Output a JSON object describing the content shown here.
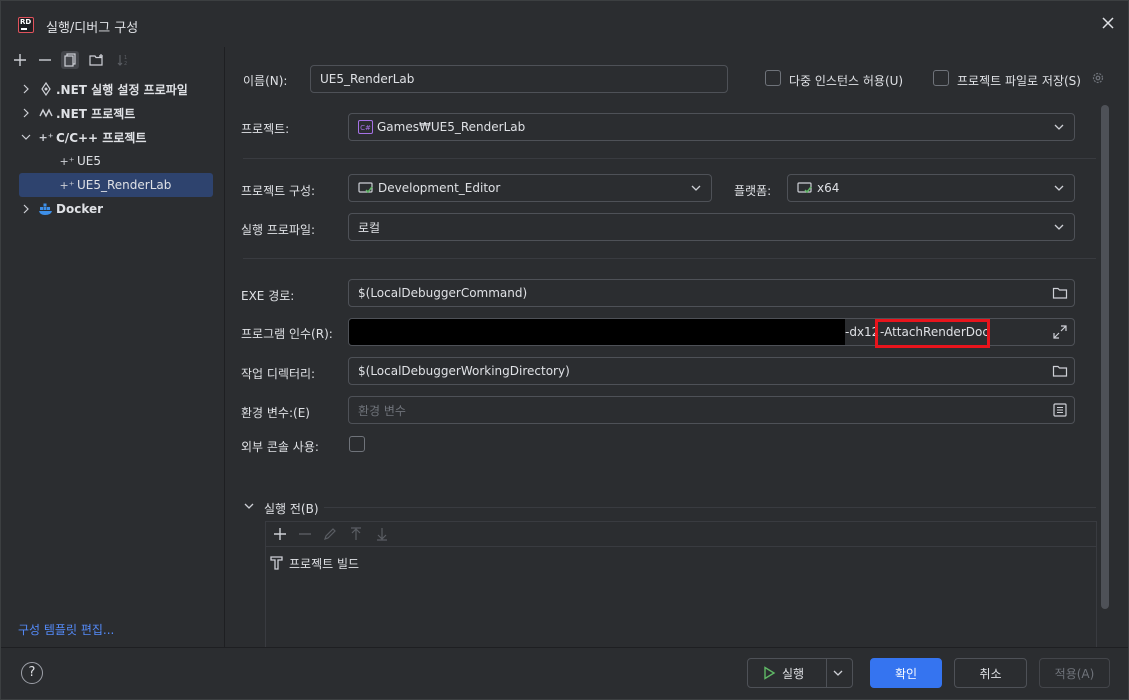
{
  "window": {
    "title": "실행/디버그 구성",
    "logo_text": "RD"
  },
  "left_toolbar": {
    "icons": [
      "add-icon",
      "remove-icon",
      "copy-icon",
      "new-folder-icon",
      "sort-icon"
    ]
  },
  "tree": {
    "items": [
      {
        "label": ".NET 실행 설정 프로파일",
        "icon": "dotnet-launch-icon"
      },
      {
        "label": ".NET 프로젝트",
        "icon": "dotnet-project-icon"
      },
      {
        "label": "C/C++ 프로젝트",
        "icon": "cpp-icon"
      },
      {
        "label": "UE5",
        "icon": "cpp-icon"
      },
      {
        "label": "UE5_RenderLab",
        "icon": "cpp-icon"
      },
      {
        "label": "Docker",
        "icon": "docker-icon"
      }
    ],
    "cpp_glyph": "+⁺"
  },
  "template_link": "구성 템플릿 편집...",
  "form": {
    "name_label": "이름(N):",
    "name_value": "UE5_RenderLab",
    "multi_instance_label": "다중 인스턴스 허용(U)",
    "store_project_label": "프로젝트 파일로 저장(S)",
    "project_label": "프로젝트:",
    "project_value": "Games₩UE5_RenderLab",
    "project_badge": "C#",
    "project_config_label": "프로젝트 구성:",
    "project_config_value": "Development_Editor",
    "platform_label": "플랫폼:",
    "platform_value": "x64",
    "launch_profile_label": "실행 프로파일:",
    "launch_profile_value": "로컬",
    "exe_path_label": "EXE 경로:",
    "exe_path_value": "$(LocalDebuggerCommand)",
    "program_args_label": "프로그램 인수(R):",
    "program_args_dx": "-dx12",
    "program_args_highlight": "-AttachRenderDoc",
    "working_dir_label": "작업 디렉터리:",
    "working_dir_value": "$(LocalDebuggerWorkingDirectory)",
    "env_label": "환경 변수:(E)",
    "env_placeholder": "환경 변수",
    "external_console_label": "외부 콘솔 사용:",
    "before_launch_label": "실행 전(B)",
    "before_launch_item": "프로젝트 빌드"
  },
  "footer": {
    "help": "?",
    "run": "실행",
    "ok": "확인",
    "cancel": "취소",
    "apply": "적용(A)"
  },
  "colors": {
    "background": "#2b2d30",
    "accent": "#3574f0",
    "selection": "#2e436e",
    "highlight_box": "#e8141c",
    "link": "#548af7"
  }
}
